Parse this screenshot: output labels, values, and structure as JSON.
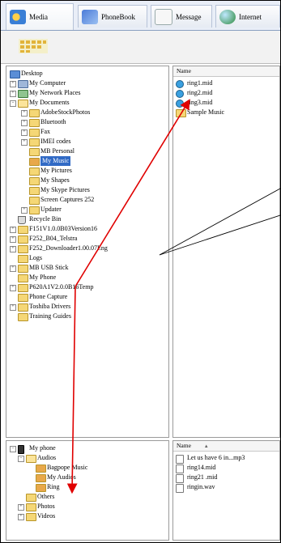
{
  "tabs": [
    {
      "label": "Media",
      "active": true
    },
    {
      "label": "PhoneBook",
      "active": false
    },
    {
      "label": "Message",
      "active": false
    },
    {
      "label": "Internet",
      "active": false
    }
  ],
  "tree_top": {
    "items": [
      {
        "label": "Desktop",
        "icon": "desktop-icon"
      },
      {
        "label": "My Computer",
        "icon": "computer-icon"
      },
      {
        "label": "My Network Places",
        "icon": "network-icon"
      },
      {
        "label": "My Documents",
        "icon": "folder-open-icon"
      },
      {
        "label": "AdobeStockPhotos",
        "icon": "folder-icon"
      },
      {
        "label": "Bluetooth",
        "icon": "folder-icon"
      },
      {
        "label": "Fax",
        "icon": "folder-icon"
      },
      {
        "label": "IMEI codes",
        "icon": "folder-icon"
      },
      {
        "label": "MB Personal",
        "icon": "folder-icon"
      },
      {
        "label": "My Music",
        "icon": "music-folder-icon",
        "selected": true
      },
      {
        "label": "My Pictures",
        "icon": "folder-icon"
      },
      {
        "label": "My Shapes",
        "icon": "folder-icon"
      },
      {
        "label": "My Skype Pictures",
        "icon": "folder-icon"
      },
      {
        "label": "Screen Captures 252",
        "icon": "folder-icon"
      },
      {
        "label": "Updater",
        "icon": "folder-icon"
      },
      {
        "label": "Recycle Bin",
        "icon": "recycle-bin-icon"
      },
      {
        "label": "F151V1.0.0B03Version16",
        "icon": "folder-icon"
      },
      {
        "label": "F252_B04_Telstra",
        "icon": "folder-icon"
      },
      {
        "label": "F252_Downloader1.00.07Eng",
        "icon": "folder-icon"
      },
      {
        "label": "Logs",
        "icon": "folder-icon"
      },
      {
        "label": "MB USB Stick",
        "icon": "folder-icon"
      },
      {
        "label": "My Phone",
        "icon": "folder-icon"
      },
      {
        "label": "P620A1V2.0.0B16Temp",
        "icon": "folder-icon"
      },
      {
        "label": "Phone Capture",
        "icon": "folder-icon"
      },
      {
        "label": "Toshiba Drivers",
        "icon": "folder-icon"
      },
      {
        "label": "Training Guides",
        "icon": "folder-icon"
      }
    ]
  },
  "files_top": {
    "header": "Name",
    "items": [
      {
        "label": "ring1.mid",
        "icon": "media-file-icon"
      },
      {
        "label": "ring2.mid",
        "icon": "media-file-icon"
      },
      {
        "label": "ring3.mid",
        "icon": "media-file-icon"
      },
      {
        "label": "Sample Music",
        "icon": "folder-icon"
      }
    ]
  },
  "tree_bottom": {
    "items": [
      {
        "label": "My phone",
        "icon": "phone-icon"
      },
      {
        "label": "Audios",
        "icon": "folder-open-icon"
      },
      {
        "label": "Bagpope Music",
        "icon": "music-folder-icon"
      },
      {
        "label": "My Audios",
        "icon": "music-folder-icon"
      },
      {
        "label": "Ring",
        "icon": "music-folder-icon"
      },
      {
        "label": "Others",
        "icon": "folder-icon"
      },
      {
        "label": "Photos",
        "icon": "folder-icon"
      },
      {
        "label": "Videos",
        "icon": "folder-icon"
      }
    ]
  },
  "files_bottom": {
    "header": "Name",
    "sort_indicator": "▲",
    "items": [
      {
        "label": "Let us have 6 in...mp3",
        "icon": "file-icon"
      },
      {
        "label": "ring14.mid",
        "icon": "file-icon"
      },
      {
        "label": "ring21 .mid",
        "icon": "file-icon"
      },
      {
        "label": "ringin.wav",
        "icon": "file-icon"
      }
    ]
  },
  "colors": {
    "selection": "#316ac5",
    "arrow": "#e00000",
    "pointer": "#000000"
  }
}
